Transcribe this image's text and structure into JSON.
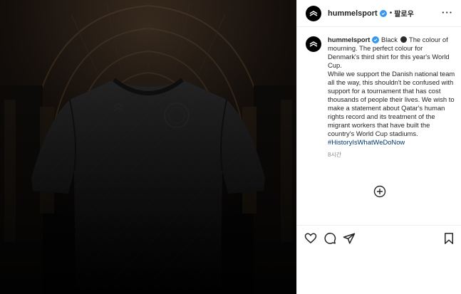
{
  "header": {
    "username": "hummelsport",
    "separator": "•",
    "follow_label": "팔로우",
    "more_label": "···"
  },
  "caption": {
    "username": "hummelsport",
    "line_1_prefix": " Black ",
    "line_1_suffix": " The colour of mourning. The perfect colour for Denmark's third shirt for this year's World Cup.",
    "line_2": "While we support the Danish national team all the way, this shouldn't be confused with support for a tournament that has cost thousands of people their lives. We wish to make a statement about Qatar's human rights record and its treatment of the migrant workers that have built the country's World Cup stadiums.",
    "hashtag": "#HistoryIsWhatWeDoNow",
    "timestamp": "8시간"
  },
  "icons": {
    "avatar": "hummel-logo-icon",
    "verified": "verified-badge-icon",
    "load_more": "plus-circle-icon",
    "like": "heart-icon",
    "comment": "comment-icon",
    "share": "paper-plane-icon",
    "save": "bookmark-icon"
  },
  "colors": {
    "verified": "#3897f0",
    "hashtag": "#00376b",
    "text": "#262626",
    "muted": "#8e8e8e"
  }
}
